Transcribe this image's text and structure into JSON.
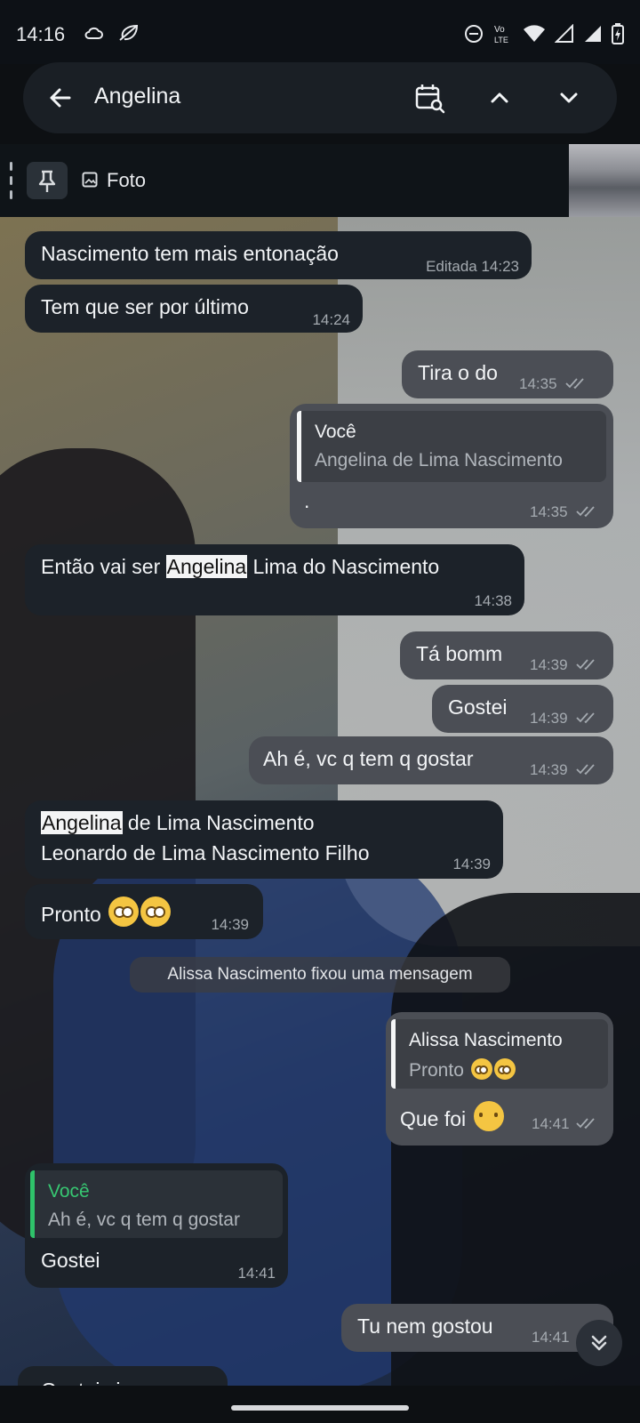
{
  "status_bar": {
    "time": "14:16",
    "left_icons": [
      "cloud-icon",
      "no-signal-leaf-icon"
    ],
    "right_icons": [
      "do-not-disturb-icon",
      "volte-icon",
      "wifi-icon",
      "signal-icon",
      "signal-icon-2",
      "battery-charging-icon"
    ],
    "volte_label_top": "Vo",
    "volte_label_bottom": "LTE"
  },
  "header": {
    "title": "Angelina",
    "icons": [
      "back-arrow-icon",
      "calendar-search-icon",
      "chevron-up-icon",
      "chevron-down-icon"
    ]
  },
  "pinned": {
    "label": "Foto",
    "icons": [
      "pin-icon",
      "photo-icon"
    ]
  },
  "messages": [
    {
      "id": "m1",
      "dir": "in",
      "text": "Nascimento tem mais entonação",
      "time": "Editada 14:23"
    },
    {
      "id": "m2",
      "dir": "in",
      "text": "Tem que ser por último",
      "time": "14:24"
    },
    {
      "id": "m3",
      "dir": "out",
      "text": "Tira o do",
      "time": "14:35"
    },
    {
      "id": "m4",
      "dir": "out",
      "reply_name": "Você",
      "reply_text": "Angelina de Lima Nascimento",
      "text": ".",
      "time": "14:35"
    },
    {
      "id": "m5",
      "dir": "in",
      "text_before": "Então vai ser ",
      "highlight": "Angelina",
      "text_after": " Lima do Nascimento",
      "time": "14:38"
    },
    {
      "id": "m6",
      "dir": "out",
      "text": "Tá bomm",
      "time": "14:39"
    },
    {
      "id": "m7",
      "dir": "out",
      "text": "Gostei",
      "time": "14:39"
    },
    {
      "id": "m8",
      "dir": "out",
      "text": "Ah é, vc q tem q gostar",
      "time": "14:39"
    },
    {
      "id": "m9",
      "dir": "in",
      "highlight": "Angelina",
      "line1_after": " de Lima Nascimento",
      "line2": "Leonardo de Lima Nascimento Filho",
      "time": "14:39"
    },
    {
      "id": "m10",
      "dir": "in",
      "text": "Pronto",
      "emoji": "eye-roll-emoji",
      "time": "14:39"
    },
    {
      "id": "m11",
      "dir": "out",
      "reply_name": "Alissa Nascimento",
      "reply_text": "Pronto",
      "text": "Que foi",
      "emoji": "raised-eyebrow-emoji",
      "time": "14:41"
    },
    {
      "id": "m12",
      "dir": "in",
      "reply_name": "Você",
      "reply_text": "Ah é, vc q tem q gostar",
      "text": "Gostei",
      "time": "14:41"
    },
    {
      "id": "m13",
      "dir": "out",
      "text": "Tu nem gostou",
      "time": "14:41"
    }
  ],
  "service_message": "Alissa Nascimento fixou uma mensagem",
  "partial_message": "Gostei sim",
  "colors": {
    "incoming_bubble": "#1c2229",
    "outgoing_bubble": "#4b4e55",
    "reply_accent_green": "#2fc26a"
  }
}
